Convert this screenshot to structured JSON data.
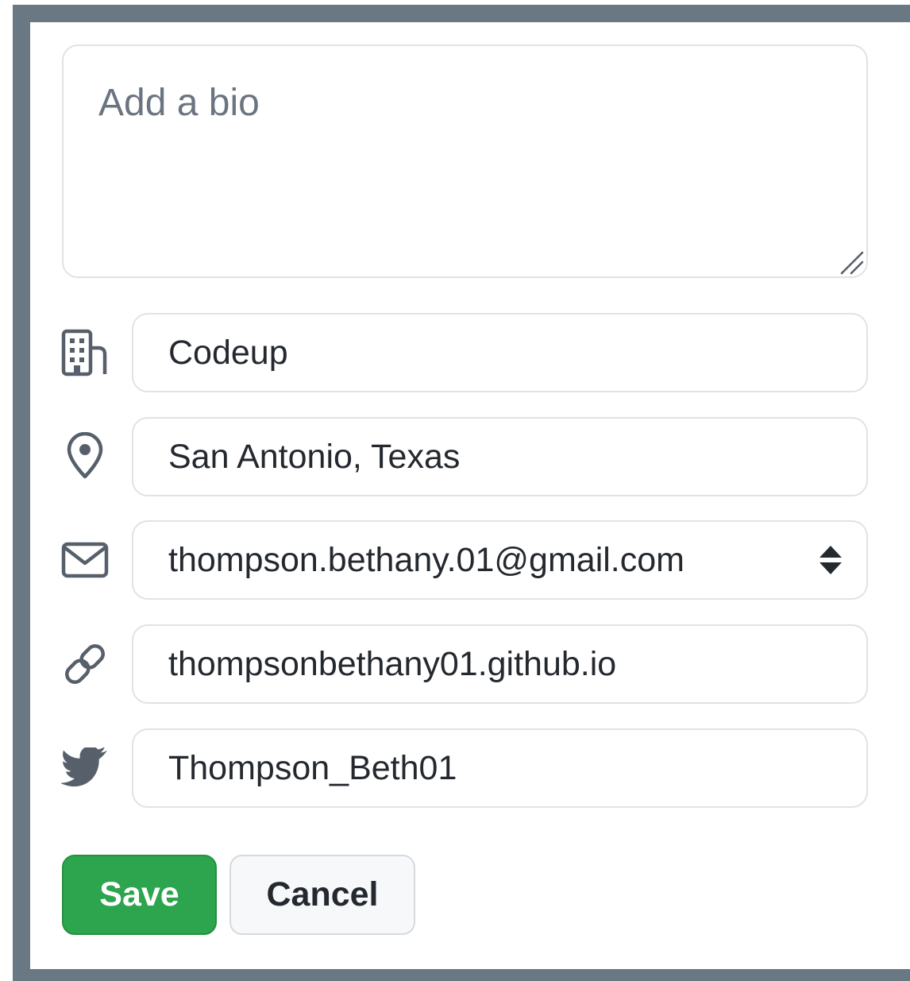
{
  "bio": {
    "placeholder": "Add a bio",
    "value": ""
  },
  "fields": {
    "company": {
      "icon": "building-icon",
      "value": "Codeup"
    },
    "location": {
      "icon": "location-pin-icon",
      "value": "San Antonio, Texas"
    },
    "email": {
      "icon": "mail-icon",
      "value": "thompson.bethany.01@gmail.com"
    },
    "website": {
      "icon": "link-icon",
      "value": "thompsonbethany01.github.io"
    },
    "twitter": {
      "icon": "twitter-bird-icon",
      "value": "Thompson_Beth01"
    }
  },
  "actions": {
    "save_label": "Save",
    "cancel_label": "Cancel"
  },
  "colors": {
    "frame": "#6a7883",
    "save_bg": "#2da44e",
    "cancel_bg": "#f6f8fa",
    "icon": "#57606a"
  }
}
